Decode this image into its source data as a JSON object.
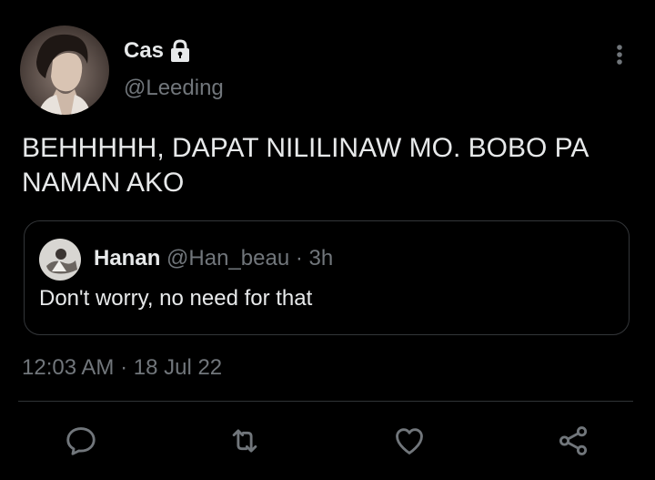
{
  "author": {
    "display_name": "Cas",
    "handle": "@Leeding",
    "protected_icon": "lock-icon"
  },
  "tweet": {
    "text": "BEHHHHH, DAPAT NILILINAW MO. BOBO PA NAMAN AKO",
    "timestamp": "12:03 AM",
    "separator": "·",
    "date": "18 Jul 22"
  },
  "quoted_tweet": {
    "display_name": "Hanan",
    "handle": "@Han_beau",
    "separator": "·",
    "time": "3h",
    "text": "Don't worry, no need for that"
  },
  "actions": {
    "reply_icon": "reply-icon",
    "retweet_icon": "retweet-icon",
    "like_icon": "heart-icon",
    "share_icon": "share-icon"
  },
  "colors": {
    "background": "#000000",
    "primary_text": "#e7e9ea",
    "secondary_text": "#71767b",
    "border": "#333639"
  }
}
